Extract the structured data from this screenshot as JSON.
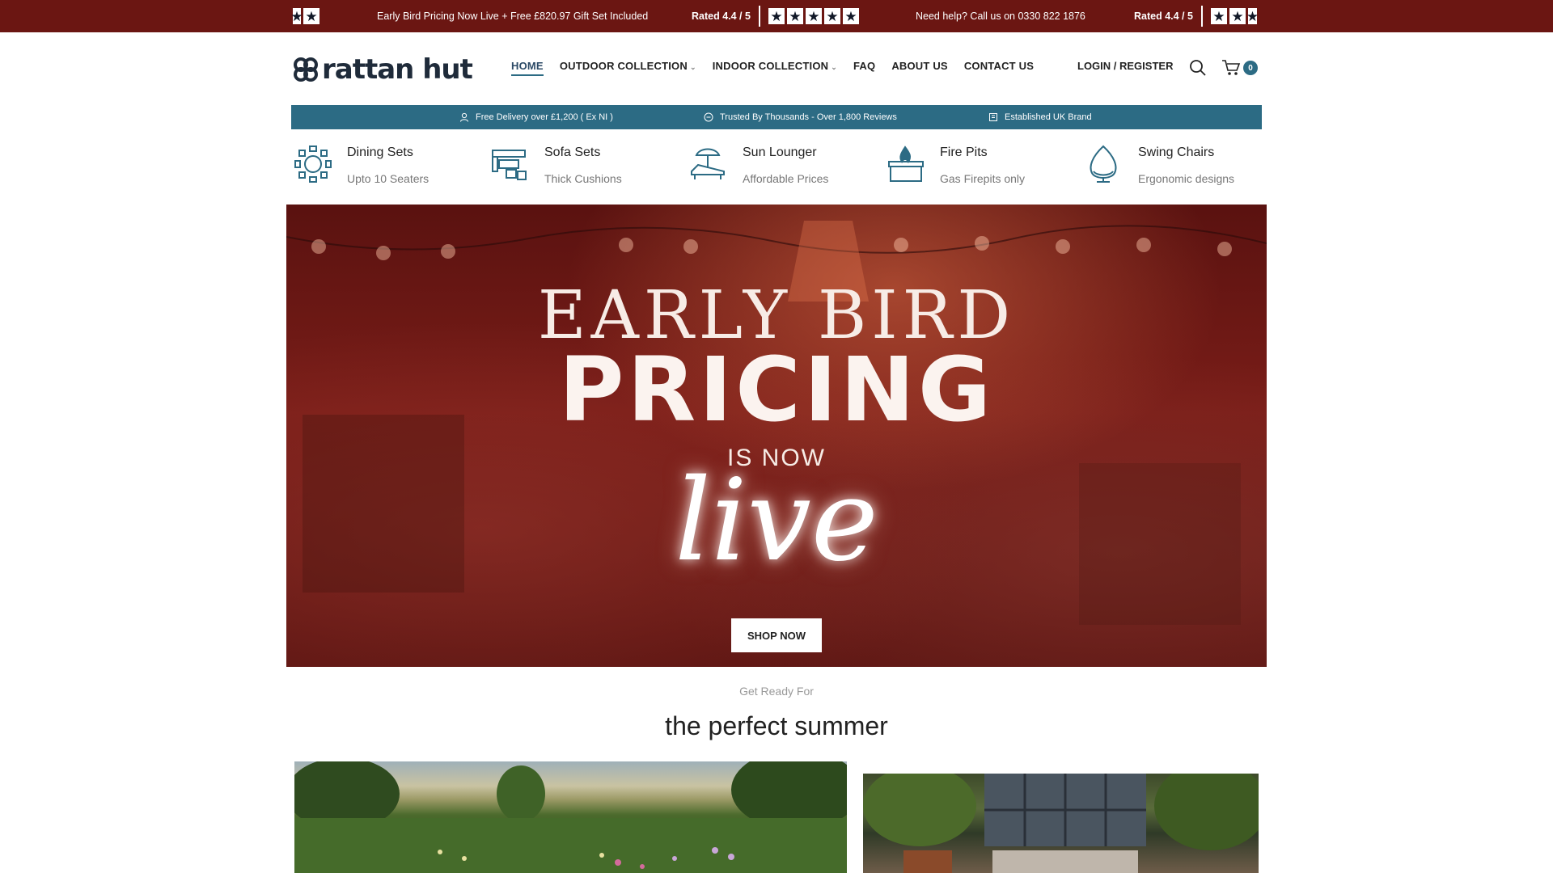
{
  "topbar": {
    "promo": "Early Bird Pricing Now Live + Free £820.97 Gift Set Included",
    "rating_1": "Rated 4.4 / 5",
    "help": "Need help? Call us on 0330 822 1876",
    "rating_2": "Rated 4.4 / 5",
    "star_glyph": "★"
  },
  "header": {
    "logo_text": "rattan hut",
    "nav": [
      {
        "label": "HOME"
      },
      {
        "label": "OUTDOOR COLLECTION"
      },
      {
        "label": "INDOOR COLLECTION"
      },
      {
        "label": "FAQ"
      },
      {
        "label": "ABOUT US"
      },
      {
        "label": "CONTACT US"
      }
    ],
    "login": "LOGIN / REGISTER",
    "cart_count": "0"
  },
  "info_strip": {
    "delivery": "Free Delivery over £1,200 ( Ex NI )",
    "trusted": "Trusted By Thousands - Over 1,800 Reviews",
    "established": "Established UK Brand"
  },
  "categories": [
    {
      "title": "Dining Sets",
      "subtitle": "Upto 10 Seaters",
      "icon": "dining-set-icon"
    },
    {
      "title": "Sofa Sets",
      "subtitle": "Thick Cushions",
      "icon": "sofa-set-icon"
    },
    {
      "title": "Sun Lounger",
      "subtitle": "Affordable Prices",
      "icon": "sun-lounger-icon"
    },
    {
      "title": "Fire Pits",
      "subtitle": "Gas Firepits only",
      "icon": "fire-pit-icon"
    },
    {
      "title": "Swing Chairs",
      "subtitle": "Ergonomic designs",
      "icon": "swing-chair-icon"
    }
  ],
  "hero": {
    "line1": "EARLY BIRD",
    "line2": "PRICING",
    "line3": "IS NOW",
    "line4": "live",
    "button": "SHOP NOW"
  },
  "section": {
    "kicker": "Get Ready For",
    "title": "the perfect summer"
  },
  "colors": {
    "topbar_bg": "#6b1612",
    "accent": "#2c6b84",
    "dark_text": "#222222"
  }
}
